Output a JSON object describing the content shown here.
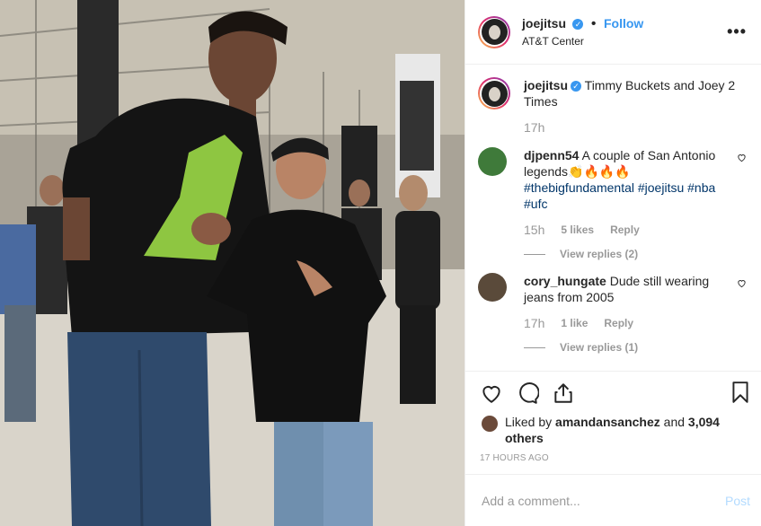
{
  "header": {
    "username": "joejitsu",
    "dot": "•",
    "follow": "Follow",
    "location": "AT&T Center",
    "more": "•••"
  },
  "caption": {
    "username": "joejitsu",
    "text": "Timmy Buckets and Joey 2 Times",
    "time": "17h"
  },
  "comments": [
    {
      "username": "djpenn54",
      "text": "A couple of San Antonio legends👏🔥🔥🔥",
      "tags": "#thebigfundamental #joejitsu #nba #ufc",
      "time": "15h",
      "likes": "5 likes",
      "reply": "Reply",
      "view_replies": "View replies (2)",
      "avatar_color": "#3f7a3a"
    },
    {
      "username": "cory_hungate",
      "text": "Dude still wearing jeans from 2005",
      "time": "17h",
      "likes": "1 like",
      "reply": "Reply",
      "view_replies": "View replies (1)",
      "avatar_color": "#5a4a3a"
    }
  ],
  "liked_by": {
    "prefix": "Liked by",
    "user": "amandansanchez",
    "and": "and",
    "count": "3,094 others"
  },
  "timestamp": "17 HOURS AGO",
  "add_comment": {
    "placeholder": "Add a comment...",
    "post": "Post"
  },
  "icons": {
    "like": "heart-icon",
    "comment": "comment-icon",
    "share": "share-icon",
    "save": "bookmark-icon"
  }
}
